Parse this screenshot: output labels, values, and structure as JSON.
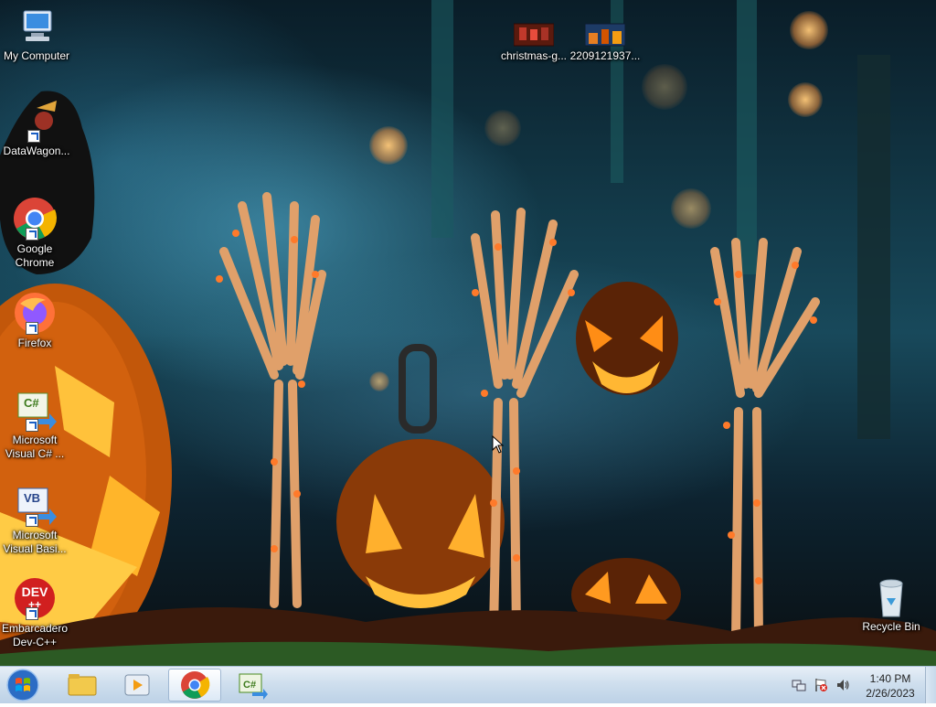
{
  "desktop": {
    "icons_left": [
      {
        "label": "My Computer",
        "icon": "my-computer-icon"
      },
      {
        "label": "DataWagon...",
        "icon": "datawagon-icon"
      },
      {
        "label": "Google Chrome",
        "icon": "chrome-icon"
      },
      {
        "label": "Firefox",
        "icon": "firefox-icon"
      },
      {
        "label": "Microsoft Visual C# ...",
        "icon": "visual-csharp-icon"
      },
      {
        "label": "Microsoft Visual Basi...",
        "icon": "visual-basic-icon"
      },
      {
        "label": "Embarcadero Dev-C++",
        "icon": "devcpp-icon"
      }
    ],
    "icons_top": [
      {
        "label": "christmas-g...",
        "icon": "image-thumbnail-icon"
      },
      {
        "label": "2209121937...",
        "icon": "image-thumbnail-icon"
      }
    ],
    "recycle_bin": {
      "label": "Recycle Bin",
      "icon": "recycle-bin-icon"
    },
    "devcpp_badge": {
      "top": "DEV",
      "bottom": "++"
    },
    "csharp_badge": "C#",
    "vb_badge": "VB"
  },
  "taskbar": {
    "start": {
      "icon": "windows-start-icon"
    },
    "pinned": [
      {
        "name": "explorer",
        "icon": "folder-icon"
      },
      {
        "name": "media-player",
        "icon": "media-player-icon"
      },
      {
        "name": "chrome",
        "icon": "chrome-icon",
        "active": true
      },
      {
        "name": "visual-csharp",
        "icon": "visual-csharp-icon"
      }
    ],
    "tray": [
      "network-icon",
      "action-center-flag-icon",
      "volume-icon"
    ],
    "clock": {
      "time": "1:40 PM",
      "date": "2/26/2023"
    }
  }
}
